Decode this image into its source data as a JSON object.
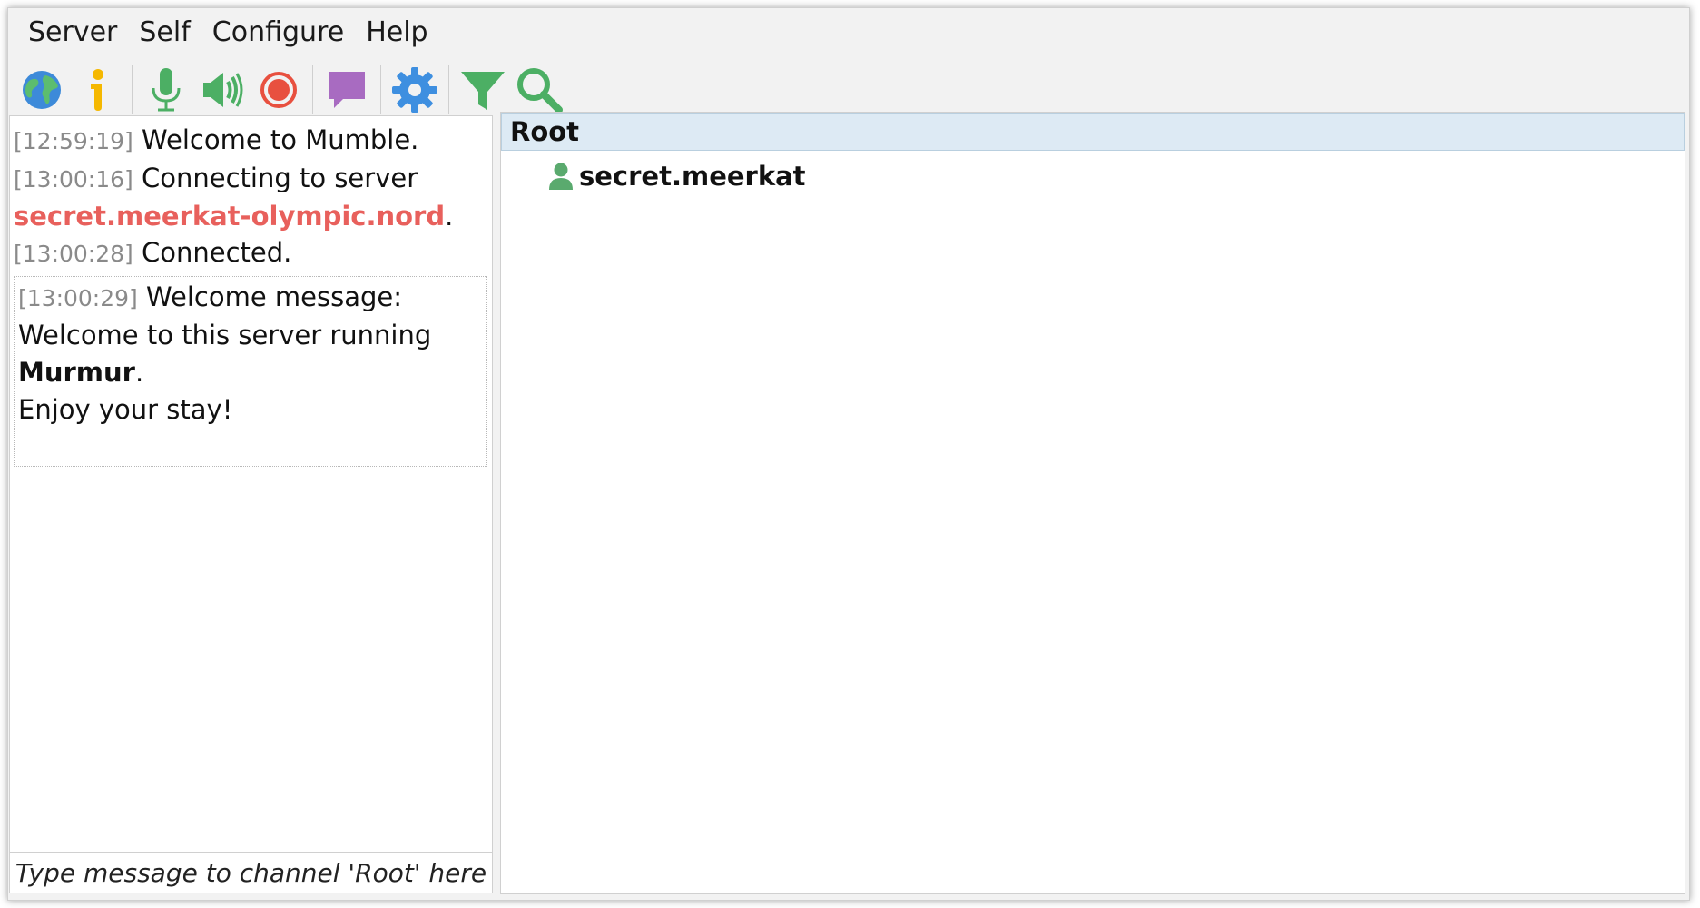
{
  "menu": [
    "Server",
    "Self",
    "Configure",
    "Help"
  ],
  "toolbar": {
    "icons": [
      "globe-icon",
      "info-icon",
      "microphone-icon",
      "speaker-icon",
      "record-icon",
      "comment-icon",
      "gear-icon",
      "filter-icon",
      "search-icon"
    ]
  },
  "chat": {
    "entries": [
      {
        "time": "[12:59:19]",
        "text": " Welcome to Mumble."
      },
      {
        "time": "[13:00:16]",
        "text": " Connecting to server",
        "server": "secret.meerkat-olympic.nord",
        "after": "."
      },
      {
        "time": "[13:00:28]",
        "text": " Connected."
      }
    ],
    "welcome": {
      "time": "[13:00:29]",
      "title": " Welcome message:",
      "line1": "Welcome to this server running",
      "bold": "Murmur",
      "bold_after": ".",
      "line3": "Enjoy your stay!"
    },
    "input_placeholder": "Type message to channel 'Root' here"
  },
  "tree": {
    "root": "Root",
    "user": "secret.meerkat"
  },
  "colors": {
    "server_link": "#e8605c",
    "user_icon": "#5aaa6e",
    "root_highlight": "#ddeaf4"
  }
}
